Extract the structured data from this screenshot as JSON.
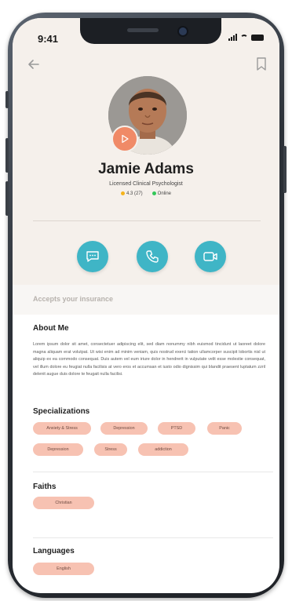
{
  "status_bar": {
    "time": "9:41"
  },
  "profile": {
    "name": "Jamie Adams",
    "title": "Licensed Clinical Psychologist",
    "rating": "4.3 (27)",
    "presence": "Online"
  },
  "colors": {
    "accent": "#3fb5c6",
    "chip": "#f7c2b2",
    "play": "#f08a67",
    "online": "#33c759",
    "star": "#f5b31b"
  },
  "icons": {
    "back": "arrow-left-icon",
    "bookmark": "bookmark-icon",
    "play": "play-icon",
    "message": "chat-icon",
    "phone": "phone-icon",
    "video": "video-icon"
  },
  "insurance": {
    "label": "Accepts your insurance"
  },
  "about": {
    "heading": "About Me",
    "text": "Lorem ipsum dolor sit amet, consectetuer adipiscing elit, sed diam nonummy nibh euismod tincidunt ut laoreet dolore magna aliquam erat volutpat. Ut wisi enim ad minim veniam, quis nostrud exerci tation ullamcorper suscipit lobortis nisl ut aliquip ex ea commodo consequat. Duis autem vel eum iriure dolor in hendrerit in vulputate velit esse molestie consequat, vel illum dolore eu feugiat nulla facilisis at vero eros et accumsan et iusto odio dignissim qui blandit praesent luptatum zzril delenit augue duis dolore te feugait nulla facilisi."
  },
  "specializations": {
    "heading": "Specializations",
    "items": [
      "Anxiety & Stress",
      "Depression",
      "PTSD",
      "Panic",
      "Depression",
      "Stress",
      "addiction"
    ]
  },
  "faiths": {
    "heading": "Faiths",
    "items": [
      "Christian"
    ]
  },
  "languages": {
    "heading": "Languages",
    "items": [
      "English"
    ]
  }
}
